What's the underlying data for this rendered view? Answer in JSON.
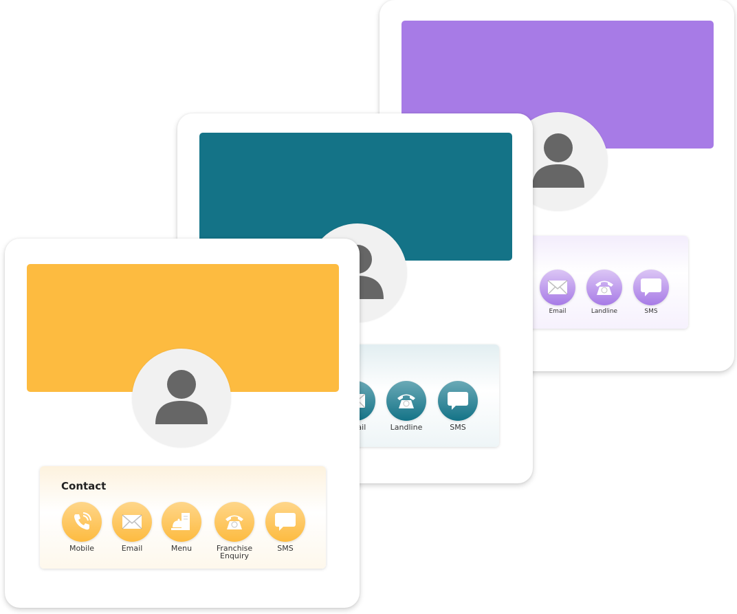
{
  "colors": {
    "yellow": "#fdbb40",
    "teal": "#147387",
    "purple": "#a77be6"
  },
  "cards": [
    {
      "name": "purple",
      "items": [
        {
          "label": "Email",
          "icon": "envelope-icon"
        },
        {
          "label": "Landline",
          "icon": "telephone-icon"
        },
        {
          "label": "SMS",
          "icon": "chat-bubble-icon"
        }
      ]
    },
    {
      "name": "teal",
      "items": [
        {
          "label": "Email",
          "icon": "envelope-icon"
        },
        {
          "label": "Landline",
          "icon": "telephone-icon"
        },
        {
          "label": "SMS",
          "icon": "chat-bubble-icon"
        }
      ]
    },
    {
      "name": "yellow",
      "title": "Contact",
      "items": [
        {
          "label": "Mobile",
          "icon": "mobile-call-icon"
        },
        {
          "label": "Email",
          "icon": "envelope-icon"
        },
        {
          "label": "Menu",
          "icon": "menu-cloche-icon"
        },
        {
          "label": "Franchise Enquiry",
          "icon": "telephone-icon"
        },
        {
          "label": "SMS",
          "icon": "chat-bubble-icon"
        }
      ]
    }
  ]
}
